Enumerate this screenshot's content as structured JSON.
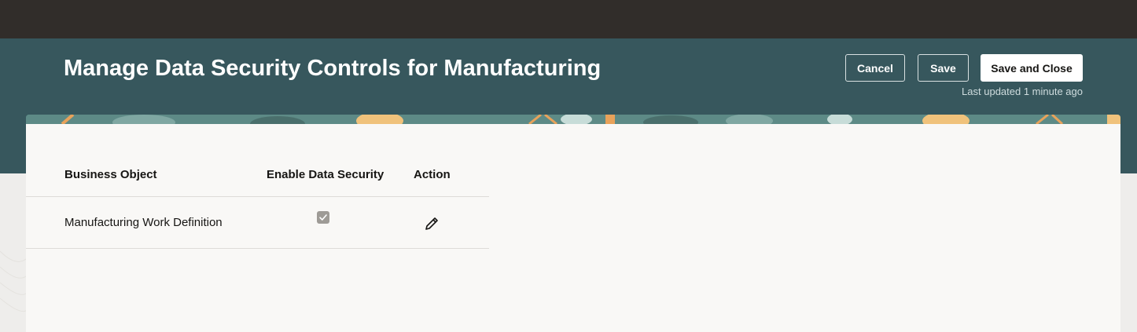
{
  "header": {
    "title": "Manage Data Security Controls for Manufacturing",
    "buttons": {
      "cancel": "Cancel",
      "save": "Save",
      "save_and_close": "Save and Close"
    },
    "last_updated": "Last updated 1 minute ago"
  },
  "table": {
    "columns": [
      "Business Object",
      "Enable Data Security",
      "Action"
    ],
    "rows": [
      {
        "business_object": "Manufacturing Work Definition",
        "enable_data_security": true,
        "action_icon": "pencil-icon"
      }
    ]
  },
  "colors": {
    "top_bar": "#312d2a",
    "header_band": "#37575d",
    "card_background": "#f9f8f6",
    "checkbox_disabled": "#9e9b96"
  }
}
